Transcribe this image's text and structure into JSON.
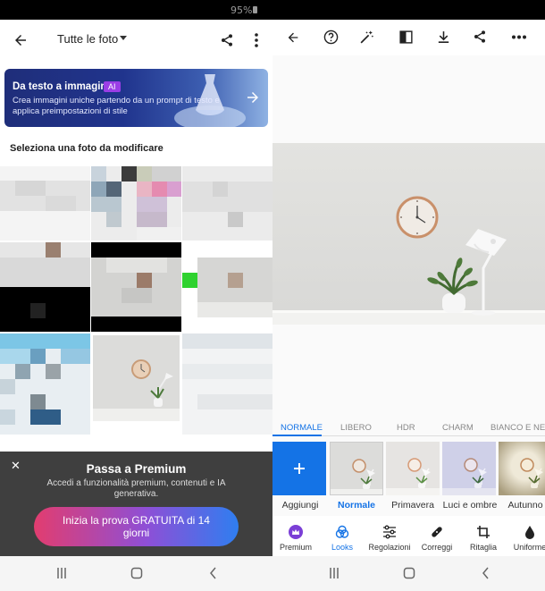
{
  "status": {
    "battery": "95%"
  },
  "left": {
    "header": {
      "title": "Tutte le foto"
    },
    "banner": {
      "title": "Da testo a immagine",
      "badge": "AI",
      "description": "Crea immagini uniche partendo da un prompt di testo e applica preimpostazioni di stile"
    },
    "section_title": "Seleziona una foto da modificare",
    "premium": {
      "title": "Passa a Premium",
      "description": "Accedi a funzionalità premium, contenuti e IA generativa.",
      "cta": "Inizia la prova GRATUITA di 14 giorni"
    }
  },
  "right": {
    "tabs": [
      "NORMALE",
      "LIBERO",
      "HDR",
      "CHARM",
      "BIANCO E NERO"
    ],
    "active_tab": "NORMALE",
    "looks": [
      "Aggiungi",
      "Normale",
      "Primavera",
      "Luci e ombre",
      "Autunno"
    ],
    "active_look": "Normale",
    "tools": [
      "Premium",
      "Looks",
      "Regolazioni",
      "Correggi",
      "Ritaglia",
      "Uniforme"
    ],
    "active_tool": "Looks"
  },
  "colors": {
    "accent": "#1473e6",
    "premium_purple": "#7b3fd6",
    "banner_badge": "#9b3ee6"
  }
}
